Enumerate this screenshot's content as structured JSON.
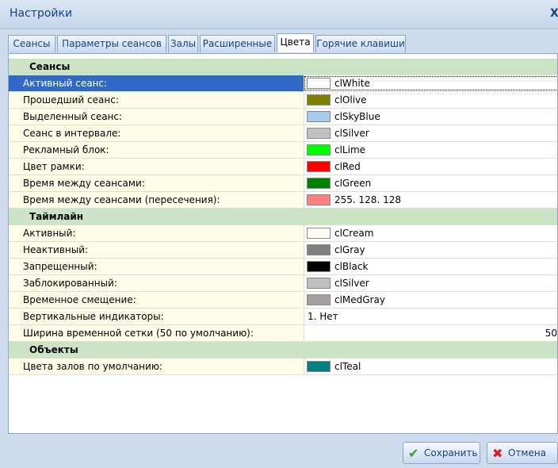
{
  "window": {
    "title": "Настройки",
    "close_label": "X"
  },
  "tabs": [
    {
      "label": "Сеансы"
    },
    {
      "label": "Параметры сеансов"
    },
    {
      "label": "Залы"
    },
    {
      "label": "Расширенные"
    },
    {
      "label": "Цвета",
      "active": true
    },
    {
      "label": "Горячие клавиши"
    }
  ],
  "colors": {
    "clWhite": "#ffffff",
    "clOlive": "#808000",
    "clSkyBlue": "#a6caf0",
    "clSilver": "#c0c0c0",
    "clLime": "#00ff00",
    "clRed": "#ff0000",
    "clGreen": "#008000",
    "pink": "#ff8080",
    "clCream": "#fffbf0",
    "clGray": "#808080",
    "clBlack": "#000000",
    "clMedGray": "#a4a0a0",
    "clTeal": "#008080",
    "selected_row": "#3169c6",
    "category_bg": "#cde3c6"
  },
  "sections": [
    {
      "title": "Сеансы",
      "rows": [
        {
          "label": "Активный сеанс:",
          "value": "clWhite",
          "color": "#ffffff",
          "selected": true
        },
        {
          "label": "Прошедший сеанс:",
          "value": "clOlive",
          "color": "#808000"
        },
        {
          "label": "Выделенный сеанс:",
          "value": "clSkyBlue",
          "color": "#a6caf0"
        },
        {
          "label": "Сеанс в интервале:",
          "value": "clSilver",
          "color": "#c0c0c0"
        },
        {
          "label": "Рекламный блок:",
          "value": "clLime",
          "color": "#00ff00"
        },
        {
          "label": "Цвет рамки:",
          "value": "clRed",
          "color": "#ff0000"
        },
        {
          "label": "Время между сеансами:",
          "value": "clGreen",
          "color": "#008000"
        },
        {
          "label": "Время между сеансами (пересечения):",
          "value": "255. 128. 128",
          "color": "#ff8080"
        }
      ]
    },
    {
      "title": "Таймлайн",
      "rows": [
        {
          "label": "Активный:",
          "value": "clCream",
          "color": "#fffbf0"
        },
        {
          "label": "Неактивный:",
          "value": "clGray",
          "color": "#808080"
        },
        {
          "label": "Запрещенный:",
          "value": "clBlack",
          "color": "#000000"
        },
        {
          "label": "Заблокированный:",
          "value": "clSilver",
          "color": "#c0c0c0"
        },
        {
          "label": "Временное смещение:",
          "value": "clMedGray",
          "color": "#a4a0a0"
        },
        {
          "label": "Вертикальные индикаторы:",
          "value": "1. Нет"
        },
        {
          "label": "Ширина временной сетки (50 по умолчанию):",
          "value": "50",
          "align": "right"
        }
      ]
    },
    {
      "title": "Объекты",
      "rows": [
        {
          "label": "Цвета залов по умолчанию:",
          "value": "clTeal",
          "color": "#008080"
        }
      ]
    }
  ],
  "footer": {
    "save_label": "Сохранить",
    "cancel_label": "Отмена"
  }
}
